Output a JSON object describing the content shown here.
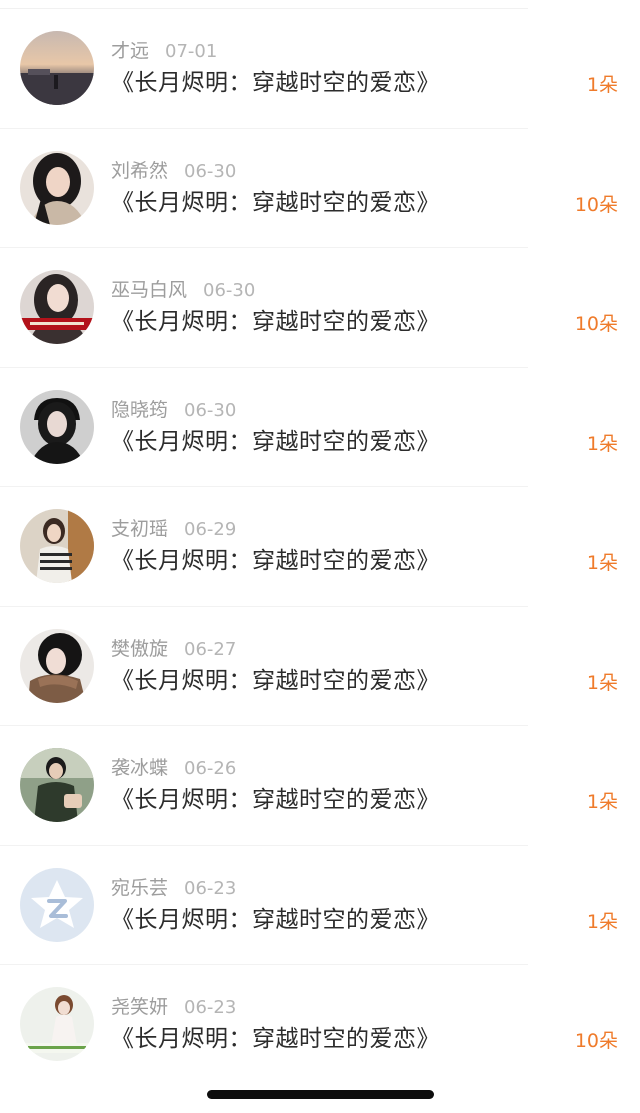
{
  "rows": [
    {
      "name": "才远",
      "date": "07-01",
      "title": "《长月烬明：穿越时空的爱恋》",
      "gift": "1朵",
      "avatar": "sunset-landscape"
    },
    {
      "name": "刘希然",
      "date": "06-30",
      "title": "《长月烬明：穿越时空的爱恋》",
      "gift": "10朵",
      "avatar": "portrait-woman"
    },
    {
      "name": "巫马白风",
      "date": "06-30",
      "title": "《长月烬明：穿越时空的爱恋》",
      "gift": "10朵",
      "avatar": "portrait-woman-banner"
    },
    {
      "name": "隐晓筠",
      "date": "06-30",
      "title": "《长月烬明：穿越时空的爱恋》",
      "gift": "1朵",
      "avatar": "portrait-woman-cap"
    },
    {
      "name": "支初瑶",
      "date": "06-29",
      "title": "《长月烬明：穿越时空的爱恋》",
      "gift": "1朵",
      "avatar": "portrait-woman-striped"
    },
    {
      "name": "樊傲旋",
      "date": "06-27",
      "title": "《长月烬明：穿越时空的爱恋》",
      "gift": "1朵",
      "avatar": "portrait-woman-scarf"
    },
    {
      "name": "袭冰蝶",
      "date": "06-26",
      "title": "《长月烬明：穿越时空的爱恋》",
      "gift": "1朵",
      "avatar": "portrait-man-green"
    },
    {
      "name": "宛乐芸",
      "date": "06-23",
      "title": "《长月烬明：穿越时空的爱恋》",
      "gift": "1朵",
      "avatar": "default-star-avatar"
    },
    {
      "name": "尧笑妍",
      "date": "06-23",
      "title": "《长月烬明：穿越时空的爱恋》",
      "gift": "10朵",
      "avatar": "portrait-woman-caption"
    }
  ],
  "colors": {
    "gift_accent": "#ef7b2b",
    "title_text": "#2c2c2c",
    "meta_text": "#9d9d9d",
    "divider": "#f2f2f2"
  }
}
